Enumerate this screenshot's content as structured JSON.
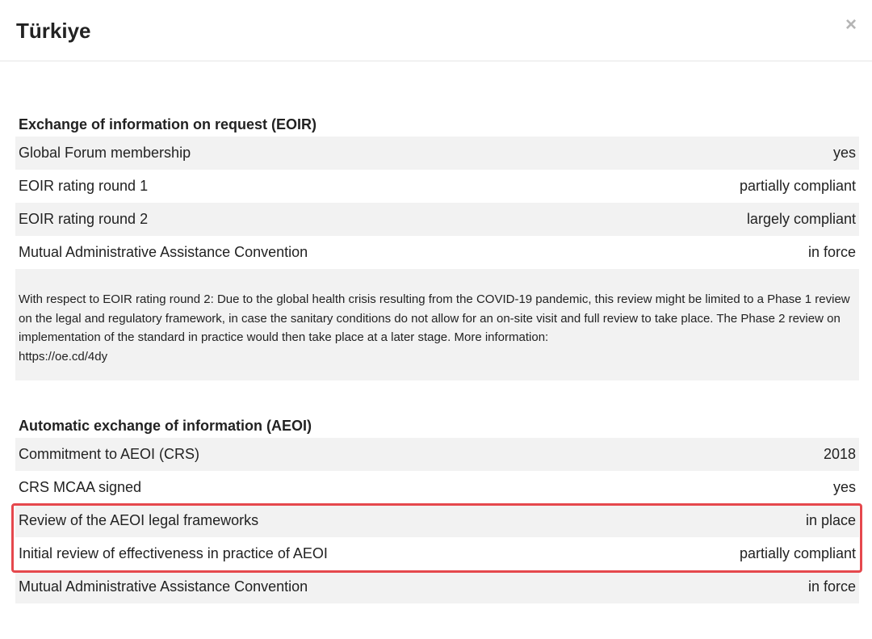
{
  "modal": {
    "title": "Türkiye",
    "close_symbol": "×"
  },
  "eoir": {
    "title": "Exchange of information on request (EOIR)",
    "rows": [
      {
        "label": "Global Forum membership",
        "value": "yes"
      },
      {
        "label": "EOIR rating round 1",
        "value": "partially compliant"
      },
      {
        "label": "EOIR rating round 2",
        "value": "largely compliant"
      },
      {
        "label": "Mutual Administrative Assistance Convention",
        "value": "in force"
      }
    ],
    "note": "With respect to EOIR rating round 2: Due to the global health crisis resulting from the COVID-19 pandemic, this review might be limited to a Phase 1 review on the legal and regulatory framework, in case the sanitary conditions do not allow for an on-site visit and full review to take place. The Phase 2 review on implementation of the standard in practice would then take place at a later stage. More information:",
    "note_link": "https://oe.cd/4dy"
  },
  "aeoi": {
    "title": "Automatic exchange of information (AEOI)",
    "rows": [
      {
        "label": "Commitment to AEOI (CRS)",
        "value": "2018"
      },
      {
        "label": "CRS MCAA signed",
        "value": "yes"
      },
      {
        "label": "Review of the AEOI legal frameworks",
        "value": "in place"
      },
      {
        "label": "Initial review of effectiveness in practice of AEOI",
        "value": "partially compliant"
      },
      {
        "label": "Mutual Administrative Assistance Convention",
        "value": "in force"
      }
    ]
  },
  "colors": {
    "highlight_border": "#e5484d",
    "row_alt_bg": "#f2f2f2",
    "close_icon": "#b5b5b5"
  },
  "icons": {
    "close": "close-icon"
  }
}
